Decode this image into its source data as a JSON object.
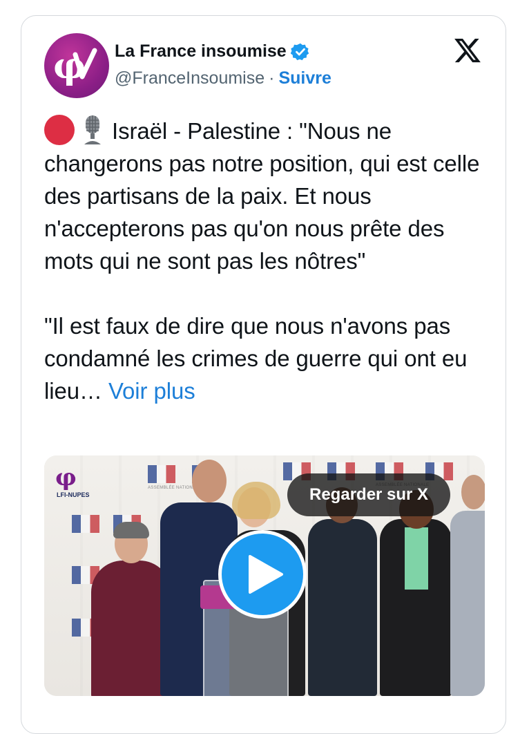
{
  "tweet": {
    "account_name": "La France insoumise",
    "handle": "@FranceInsoumise",
    "separator": "·",
    "follow_label": "Suivre",
    "text_line_1": "Israël - Palestine : \"Nous ne changerons pas notre position, qui est celle des partisans de la paix. Et nous n'accepterons pas qu'on nous prête des mots qui ne sont pas les nôtres\"",
    "text_line_2": "\"Il est faux de dire que nous n'avons pas condamné les crimes de guerre qui ont eu lieu…",
    "see_more": "Voir plus",
    "emojis": [
      "red-circle-icon",
      "studio-microphone-icon"
    ]
  },
  "media": {
    "watch_label": "Regarder sur X",
    "backdrop_label": "ASSEMBLÉE NATIONALE",
    "logo_text": "LFI-NUPES"
  },
  "colors": {
    "link": "#1d7fd8",
    "verified": "#1d9bf0",
    "avatar": "#8d1f87",
    "play": "#1d9bf0"
  }
}
